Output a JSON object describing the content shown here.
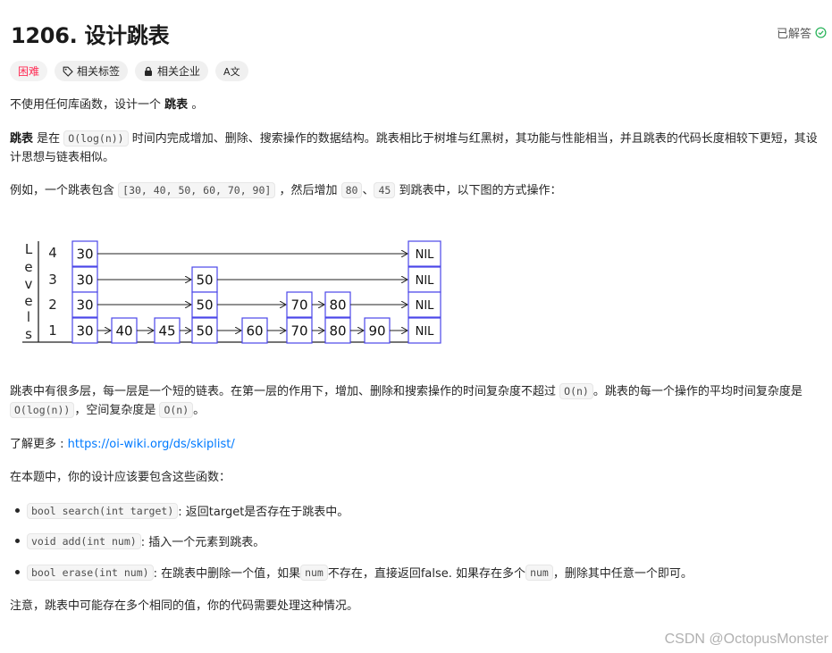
{
  "header": {
    "title": "1206. 设计跳表",
    "status": "已解答"
  },
  "tags": {
    "difficulty": "困难",
    "topics": "相关标签",
    "companies": "相关企业",
    "translate": "A文"
  },
  "content": {
    "intro_a": "不使用任何库函数，设计一个",
    "intro_bold": "跳表",
    "intro_b": "。",
    "desc_bold": "跳表",
    "desc_a": " 是在 ",
    "desc_code": "O(log(n))",
    "desc_b": " 时间内完成增加、删除、搜索操作的数据结构。跳表相比于树堆与红黑树，其功能与性能相当，并且跳表的代码长度相较下更短，其设计思想与链表相似。",
    "example_a": "例如，一个跳表包含 ",
    "example_code": "[30, 40, 50, 60, 70, 90]",
    "example_b": " ，然后增加 ",
    "example_code2": "80",
    "example_c": "、",
    "example_code3": "45",
    "example_d": " 到跳表中，以下图的方式操作：",
    "levels_a": "跳表中有很多层，每一层是一个短的链表。在第一层的作用下，增加、删除和搜索操作的时间复杂度不超过 ",
    "levels_code1": "O(n)",
    "levels_b": "。跳表的每一个操作的平均时间复杂度是 ",
    "levels_code2": "O(log(n))",
    "levels_c": "，空间复杂度是 ",
    "levels_code3": "O(n)",
    "levels_d": "。",
    "more_a": "了解更多 : ",
    "more_link": "https://oi-wiki.org/ds/skiplist/",
    "task": "在本题中，你的设计应该要包含这些函数：",
    "li1_code": "bool search(int target)",
    "li1_text": " : 返回target是否存在于跳表中。",
    "li2_code": "void add(int num)",
    "li2_text": ": 插入一个元素到跳表。",
    "li3_code": "bool erase(int num)",
    "li3_text_a": ": 在跳表中删除一个值，如果 ",
    "li3_code2": "num",
    "li3_text_b": " 不存在，直接返回false. 如果存在多个 ",
    "li3_code3": "num",
    "li3_text_c": " ，删除其中任意一个即可。",
    "note": "注意，跳表中可能存在多个相同的值，你的代码需要处理这种情况。"
  },
  "diagram": {
    "axis_letters": [
      "L",
      "e",
      "v",
      "e",
      "l",
      "s"
    ],
    "level_labels": [
      "4",
      "3",
      "2",
      "1"
    ],
    "nil_label": "NIL",
    "rows": [
      [
        "30"
      ],
      [
        "30",
        "50"
      ],
      [
        "30",
        "50",
        "70",
        "80"
      ],
      [
        "30",
        "40",
        "45",
        "50",
        "60",
        "70",
        "80",
        "90"
      ]
    ],
    "color": "#4b46e8"
  },
  "watermark": "CSDN @OctopusMonster",
  "colors": {
    "hard": "#ff2d55",
    "link": "#007aff",
    "solved_check": "#2db55d"
  }
}
